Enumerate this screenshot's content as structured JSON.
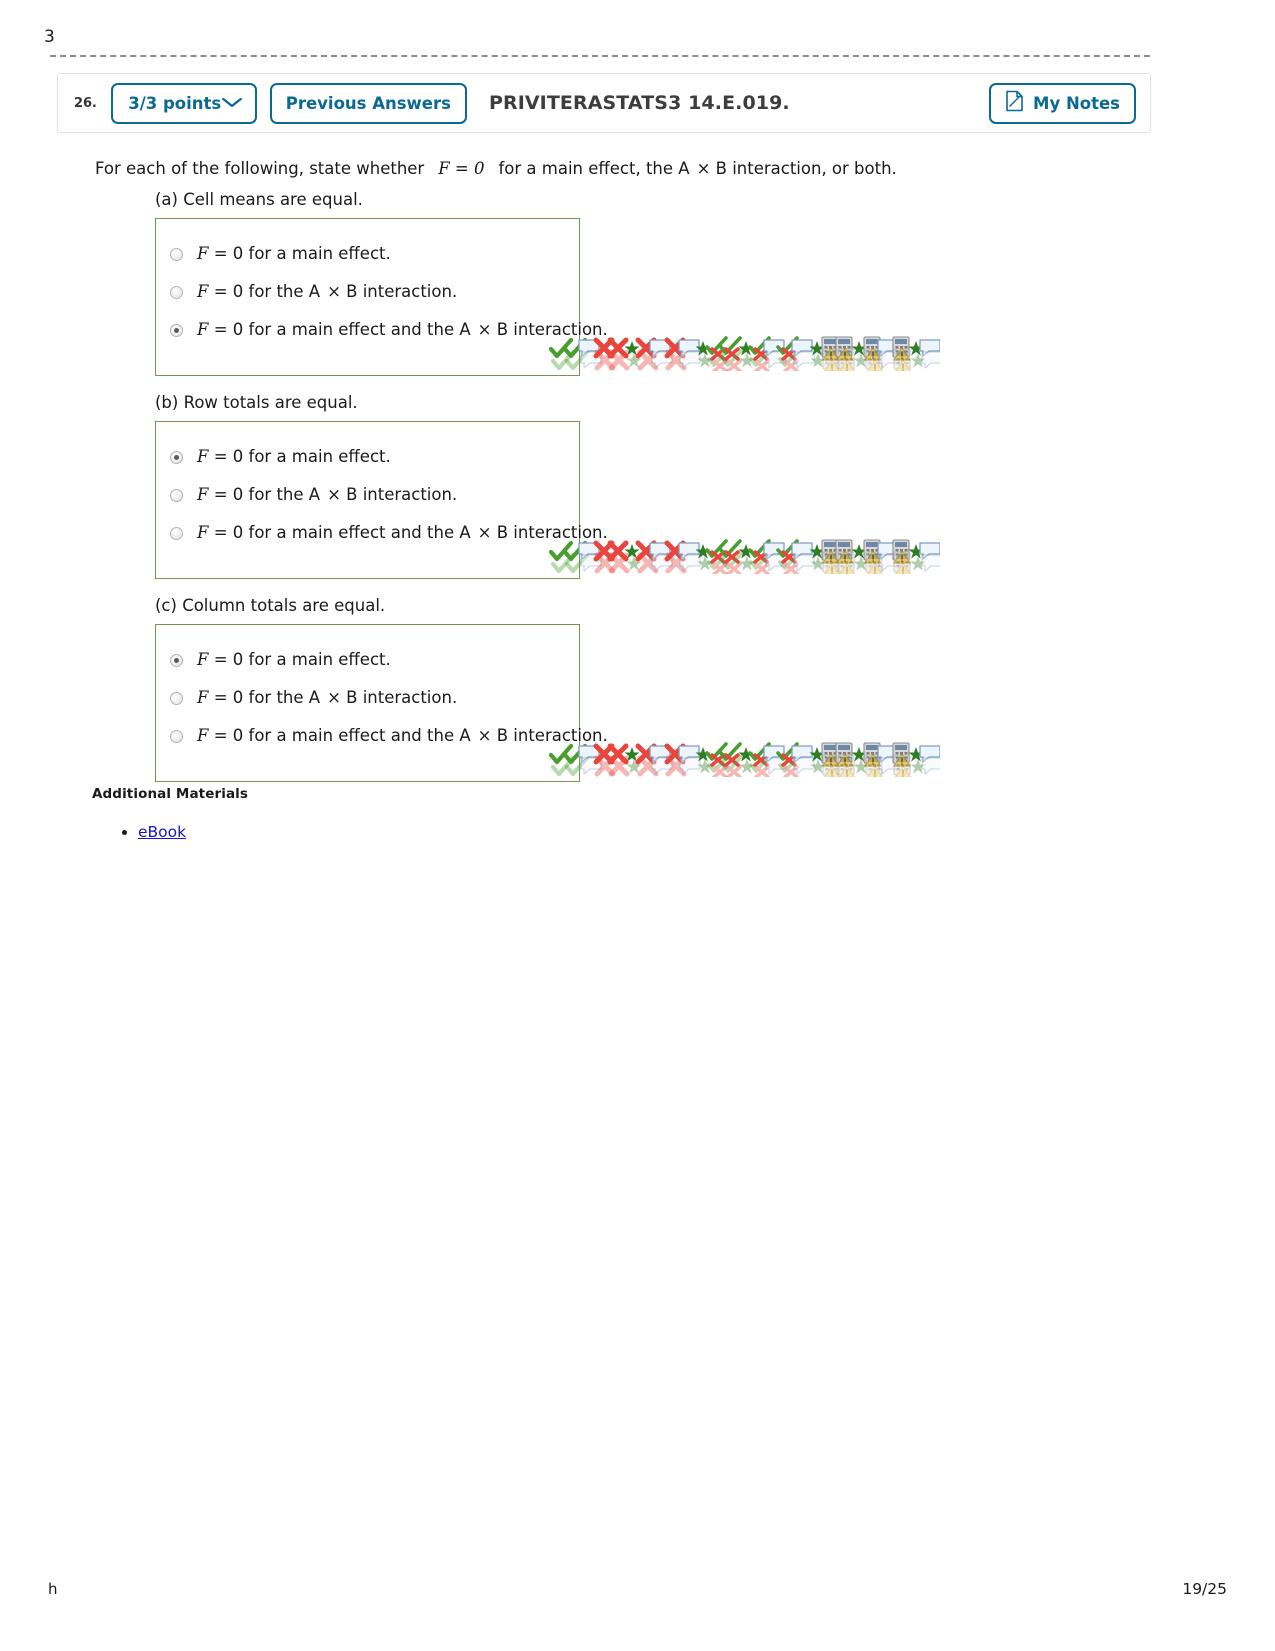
{
  "page": {
    "top_clipped_glyph": "3",
    "footer_left_clipped": "h",
    "footer_page_indicator": "19/25"
  },
  "question_header": {
    "number": "26.",
    "points_label": "3/3 points",
    "points_chevron": "chevron-down-icon",
    "previous_answers_label": "Previous Answers",
    "question_code": "PRIVITERASTATS3 14.E.019.",
    "my_notes_label": "My Notes",
    "my_notes_icon": "note-page-icon",
    "accent_color": "#0a6a92",
    "code_color": "#3d3d3d"
  },
  "prompt": {
    "lead": "For each of the following, state whether",
    "math": "F = 0",
    "tail_1": "for a main effect, the A",
    "times": "×",
    "tail_2": "B interaction, or both."
  },
  "option_texts": {
    "main_effect": {
      "f": "F",
      "eq0": "= 0 for a main effect."
    },
    "interaction": {
      "f": "F",
      "pre": "= 0 for the A",
      "times": "×",
      "post": "B interaction."
    },
    "both": {
      "f": "F",
      "pre": "= 0 for a main effect and the A",
      "times": "×",
      "post": "B interaction."
    }
  },
  "subquestions": [
    {
      "label": "(a) Cell means are equal.",
      "selected_index": 2,
      "options": [
        {
          "kind": "main_effect",
          "checked": false
        },
        {
          "kind": "interaction",
          "checked": false
        },
        {
          "kind": "both",
          "checked": true
        }
      ]
    },
    {
      "label": "(b) Row totals are equal.",
      "selected_index": 0,
      "options": [
        {
          "kind": "main_effect",
          "checked": true
        },
        {
          "kind": "interaction",
          "checked": false
        },
        {
          "kind": "both",
          "checked": false
        }
      ]
    },
    {
      "label": "(c) Column totals are equal.",
      "selected_index": 0,
      "options": [
        {
          "kind": "main_effect",
          "checked": true
        },
        {
          "kind": "interaction",
          "checked": false
        },
        {
          "kind": "both",
          "checked": false
        }
      ]
    }
  ],
  "feedback_icons": {
    "description": "overlapping grading feedback icon strip",
    "sequence": [
      "check-mark-icon",
      "check-mark-icon",
      "speech-bubble-icon",
      "cross-mark-icon",
      "cross-mark-icon",
      "star-icon",
      "cross-mark-icon",
      "speech-bubble-icon",
      "cross-mark-icon",
      "speech-bubble-icon",
      "star-icon",
      "check-cross-icon",
      "check-cross-icon",
      "star-icon",
      "check-cross-icon",
      "speech-bubble-icon",
      "check-cross-icon",
      "speech-bubble-icon",
      "star-icon",
      "calculator-warning-icon",
      "calculator-warning-icon",
      "star-icon",
      "calculator-warning-icon",
      "speech-bubble-icon",
      "calculator-warning-icon",
      "star-icon",
      "speech-bubble-icon"
    ],
    "colors": {
      "check": "#4a9e2f",
      "cross": "#e8453c",
      "star": "#2f7d25",
      "bubble_fill": "#eef4fb",
      "bubble_stroke": "#7f9dc0",
      "calc_body": "#d9d9d9",
      "warning": "#efc02a"
    }
  },
  "additional_materials": {
    "title": "Additional Materials",
    "items": [
      {
        "label": "eBook",
        "color": "#1515cd"
      }
    ]
  }
}
